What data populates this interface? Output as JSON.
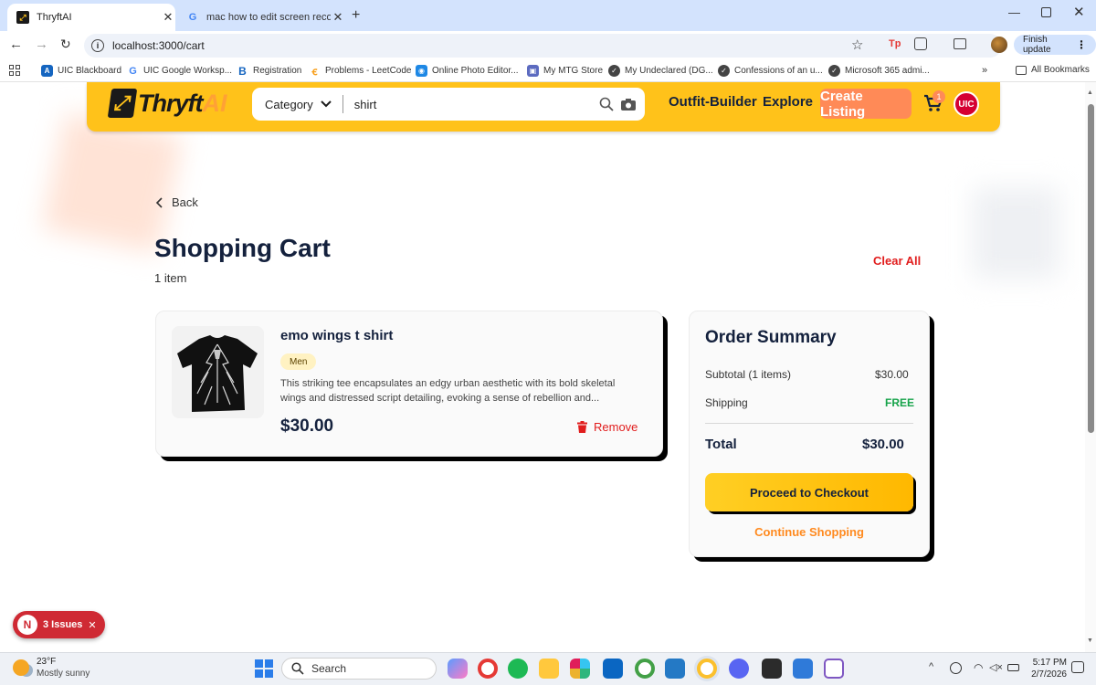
{
  "browser": {
    "tabs": [
      {
        "title": "ThryftAI",
        "active": true
      },
      {
        "title": "mac how to edit screen recordi",
        "active": false
      }
    ],
    "url": "localhost:3000/cart",
    "finish_update_label": "Finish update",
    "bookmarks": [
      "UIC Blackboard",
      "UIC Google Worksp...",
      "Registration",
      "Problems - LeetCode",
      "Online Photo Editor...",
      "My MTG Store",
      "My Undeclared (DG...",
      "Confessions of an u...",
      "Microsoft 365 admi..."
    ],
    "more_bookmarks": "»",
    "all_bookmarks_label": "All Bookmarks"
  },
  "header": {
    "logo_text": "Thryft",
    "logo_accent": "AI",
    "category_label": "Category",
    "search_value": "shirt",
    "nav": [
      "Outfit-Builder",
      "Explore"
    ],
    "create_label": "Create Listing",
    "cart_count": "1",
    "user_badge": "UIC"
  },
  "cart": {
    "back_label": "Back",
    "title": "Shopping Cart",
    "count_label": "1 item",
    "clear_all_label": "Clear All",
    "items": [
      {
        "name": "emo wings t shirt",
        "tag": "Men",
        "description": "This striking tee encapsulates an edgy urban aesthetic with its bold skeletal wings and distressed script detailing, evoking a sense of rebellion and...",
        "price": "$30.00",
        "remove_label": "Remove"
      }
    ]
  },
  "summary": {
    "title": "Order Summary",
    "subtotal_label": "Subtotal (1 items)",
    "subtotal_value": "$30.00",
    "shipping_label": "Shipping",
    "shipping_value": "FREE",
    "total_label": "Total",
    "total_value": "$30.00",
    "checkout_label": "Proceed to Checkout",
    "continue_label": "Continue Shopping"
  },
  "dev_overlay": {
    "badge": "N",
    "issues_label": "3 Issues"
  },
  "taskbar": {
    "temperature": "23°F",
    "weather": "Mostly sunny",
    "search_placeholder": "Search",
    "time": "5:17 PM",
    "date": "2/7/2026"
  },
  "colors": {
    "brand_yellow": "#ffc21a",
    "accent_orange": "#ff8a57",
    "danger_red": "#e11d1d",
    "free_green": "#16a34a",
    "navy_text": "#14213d"
  }
}
